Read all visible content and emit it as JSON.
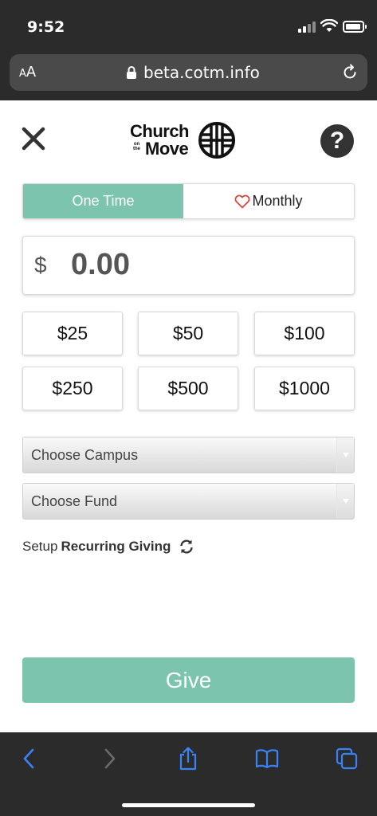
{
  "status_bar": {
    "time": "9:52"
  },
  "browser": {
    "text_size_small": "A",
    "text_size_large": "A",
    "url": "beta.cotm.info",
    "icons": [
      "lock-icon",
      "reload-icon",
      "back-icon",
      "forward-icon",
      "share-icon",
      "bookmarks-icon",
      "tabs-icon"
    ]
  },
  "header": {
    "logo_line1": "Church",
    "logo_on": "on",
    "logo_the": "the",
    "logo_line2": "Move",
    "help_label": "?"
  },
  "frequency": {
    "one_time": "One Time",
    "monthly": "Monthly",
    "selected": "One Time"
  },
  "amount": {
    "currency": "$",
    "value": "0.00"
  },
  "presets": [
    "$25",
    "$50",
    "$100",
    "$250",
    "$500",
    "$1000"
  ],
  "campus_select": {
    "placeholder": "Choose Campus"
  },
  "fund_select": {
    "placeholder": "Choose Fund"
  },
  "recurring": {
    "prefix": "Setup",
    "label": "Recurring Giving"
  },
  "give_button": "Give",
  "colors": {
    "accent": "#7cc4ae",
    "chrome": "#2b2b2b",
    "link_blue": "#3a82f7",
    "heart": "#e0463b"
  }
}
